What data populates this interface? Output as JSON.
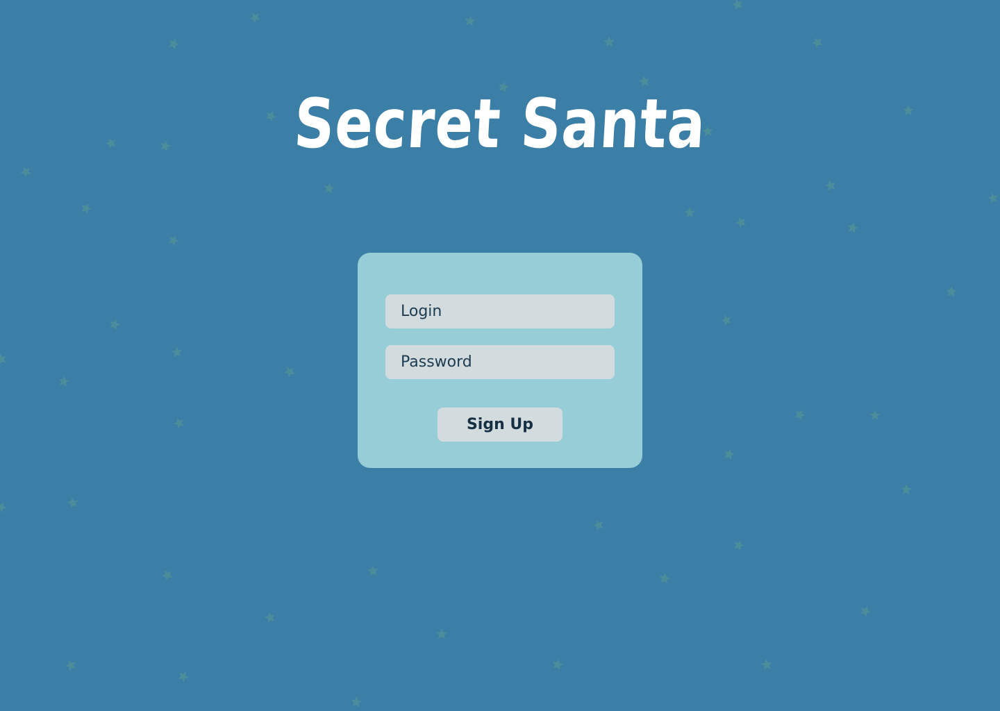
{
  "app": {
    "title": "Secret Santa"
  },
  "form": {
    "login_placeholder": "Login",
    "password_placeholder": "Password",
    "submit_label": "Sign Up"
  },
  "theme": {
    "background": "#3b7ea6",
    "card": "#96cdd7",
    "field": "#d2dcdf",
    "text": "#1e3a4f",
    "star": "#5a9a93",
    "title": "#ffffff"
  },
  "decor": {
    "star_icon": "star-icon"
  }
}
